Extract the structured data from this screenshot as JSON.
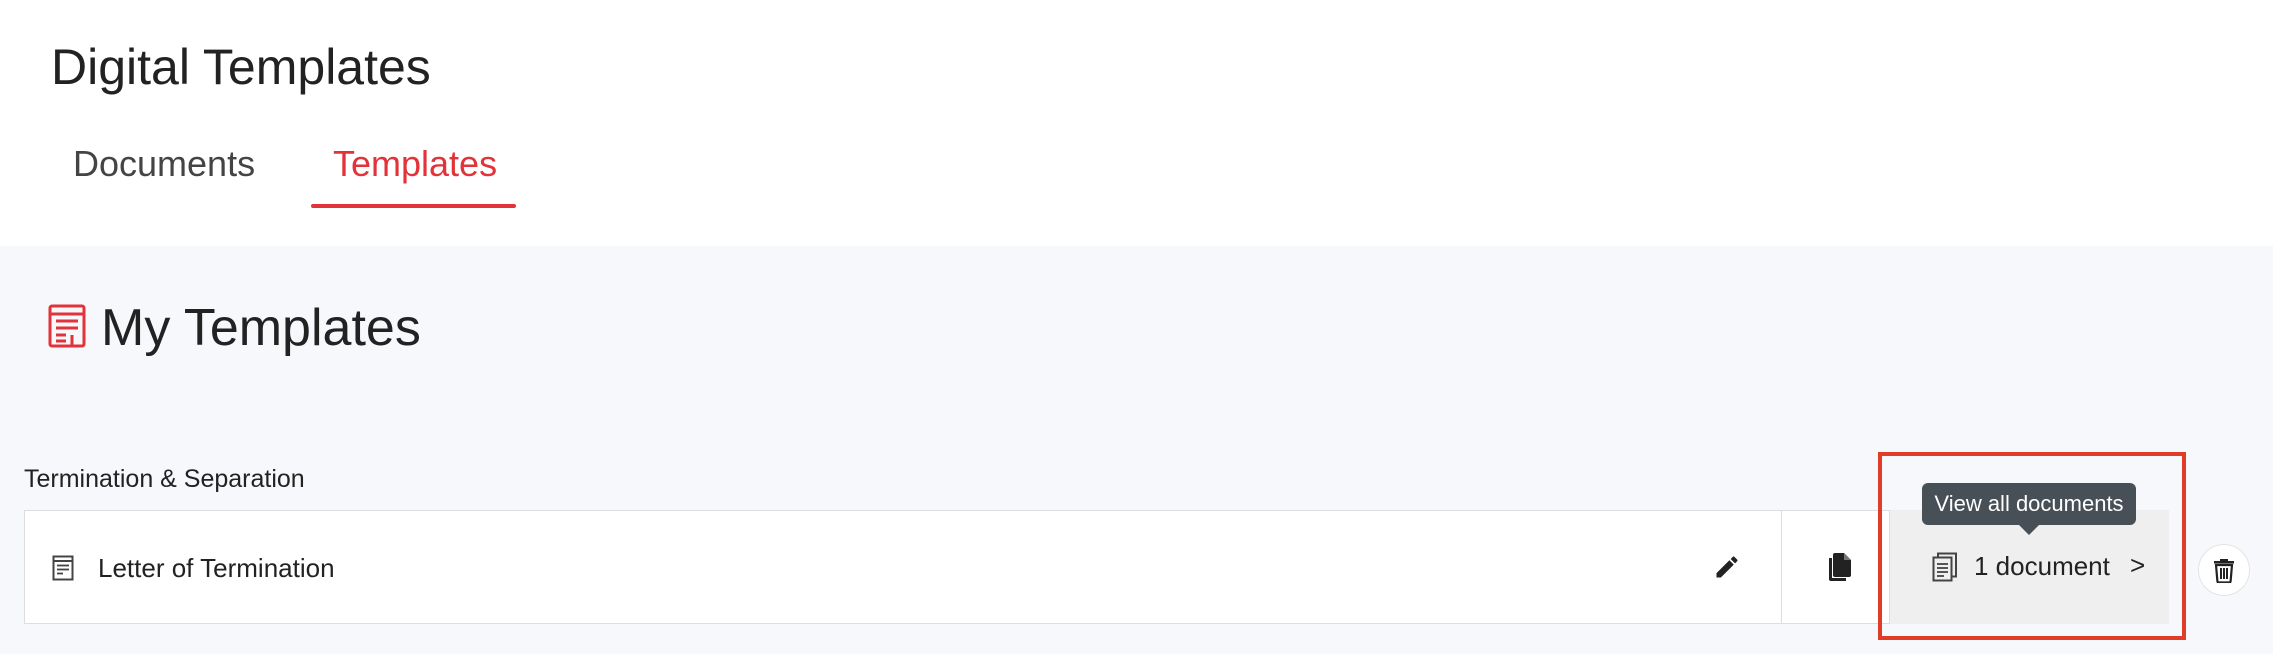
{
  "page": {
    "title": "Digital Templates"
  },
  "tabs": [
    {
      "label": "Documents",
      "active": false
    },
    {
      "label": "Templates",
      "active": true
    }
  ],
  "section": {
    "icon": "template-icon",
    "title": "My Templates"
  },
  "category": {
    "label": "Termination & Separation"
  },
  "templates": [
    {
      "icon": "document-icon",
      "name": "Letter of Termination",
      "edit_icon": "pencil-icon",
      "copy_icon": "copy-icon",
      "documents": {
        "icon": "documents-icon",
        "count_label": "1 document",
        "chevron": ">"
      },
      "delete_icon": "trash-icon"
    }
  ],
  "tooltip": {
    "text": "View all documents"
  },
  "colors": {
    "accent": "#e2333a",
    "highlight": "#e03c28",
    "tooltip_bg": "#474f57",
    "page_bg": "#f7f8fb"
  }
}
